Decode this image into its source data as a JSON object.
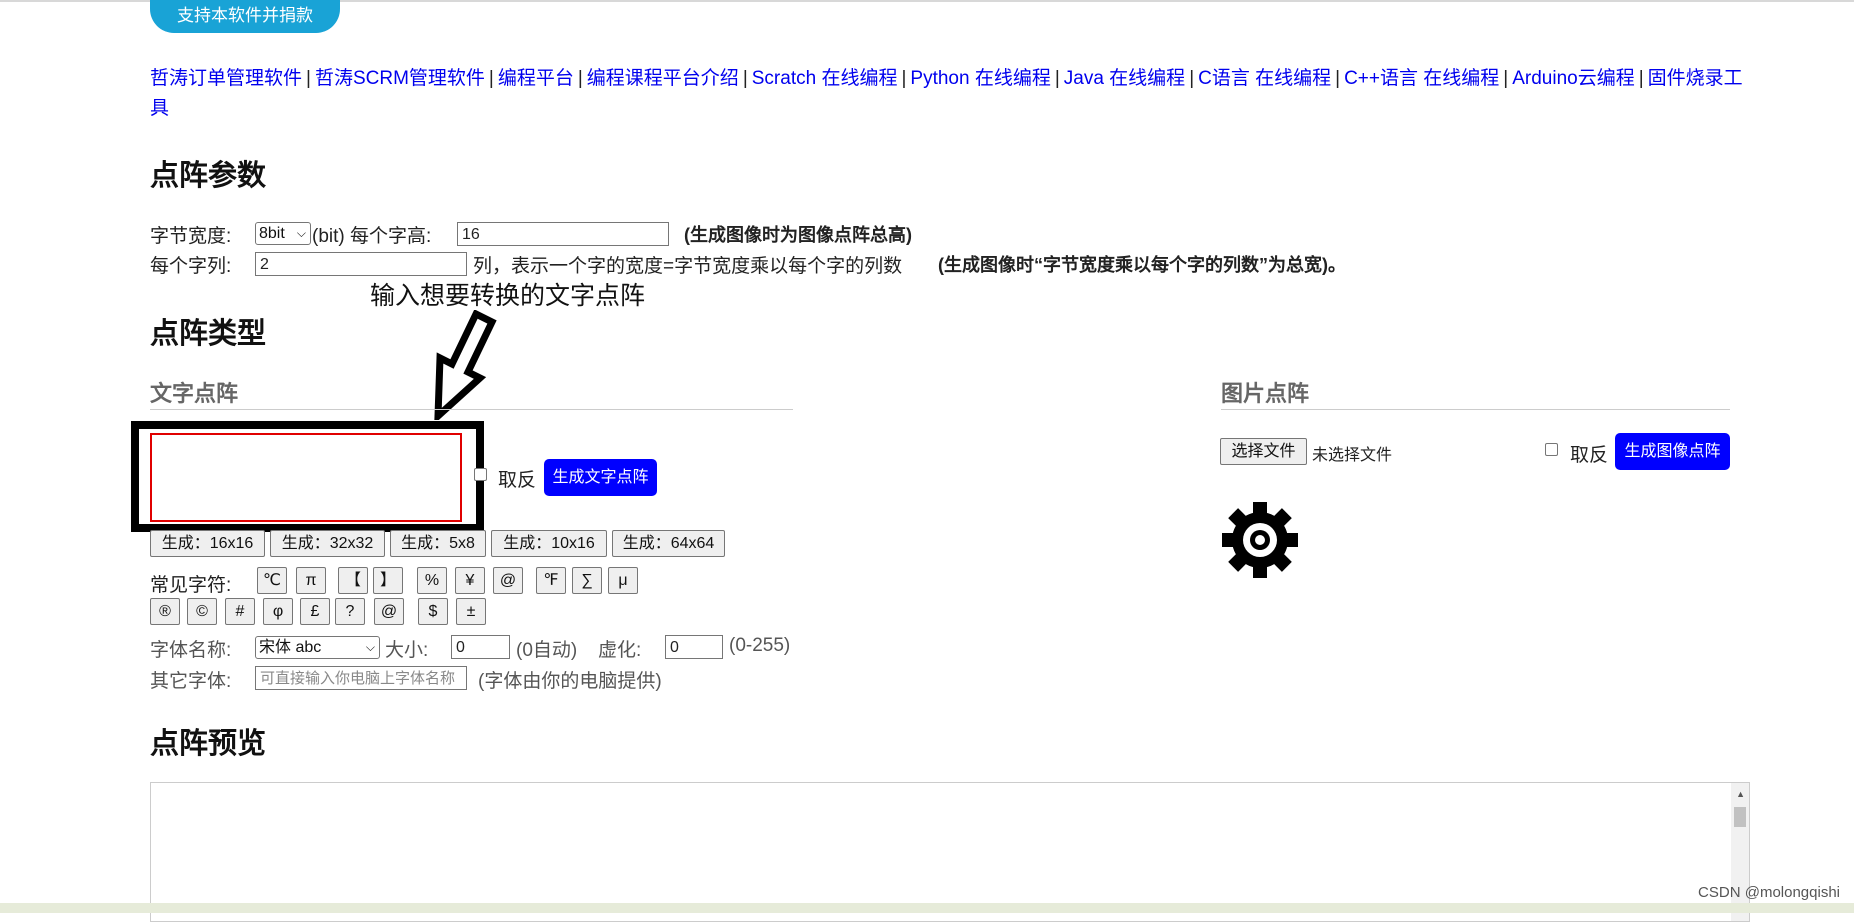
{
  "header": {
    "donate_label": "支持本软件并捐款"
  },
  "links": [
    "哲涛订单管理软件",
    "哲涛SCRM管理软件",
    "编程平台",
    "编程课程平台介绍",
    "Scratch 在线编程",
    "Python 在线编程",
    "Java 在线编程",
    "C语言 在线编程",
    "C++语言 在线编程",
    "Arduino云编程",
    "固件烧录工具"
  ],
  "link_separator": "|",
  "params": {
    "title": "点阵参数",
    "byte_width_label": "字节宽度:",
    "byte_width_value": "8bit",
    "bit_unit": "(bit)",
    "char_height_label": "每个字高:",
    "char_height_value": "16",
    "char_height_note": "(生成图像时为图像点阵总高)",
    "char_cols_label": "每个字列:",
    "char_cols_value": "2",
    "char_cols_desc": "列，表示一个字的宽度=字节宽度乘以每个字的列数",
    "char_cols_note": "(生成图像时“字节宽度乘以每个字的列数”为总宽)。"
  },
  "annotation": {
    "callout": "输入想要转换的文字点阵"
  },
  "types": {
    "title": "点阵类型",
    "text": {
      "heading": "文字点阵",
      "input_value": "",
      "invert_label": "取反",
      "generate_label": "生成文字点阵",
      "presets": [
        "生成：16x16",
        "生成：32x32",
        "生成：5x8",
        "生成：10x16",
        "生成：64x64"
      ],
      "common_label": "常见字符:",
      "symbols_row1": [
        "℃",
        "π",
        "【",
        "】",
        "%",
        "¥",
        "@",
        "℉",
        "∑",
        "μ"
      ],
      "symbols_row2": [
        "®",
        "©",
        "#",
        "φ",
        "£",
        "?",
        "@",
        "$",
        "±"
      ],
      "font_name_label": "字体名称:",
      "font_name_value": "宋体 abc",
      "size_label": "大小:",
      "size_value": "0",
      "size_note": "(0自动)",
      "blur_label": "虚化:",
      "blur_value": "0",
      "blur_note": "(0-255)",
      "other_font_label": "其它字体:",
      "other_font_placeholder": "可直接输入你电脑上字体名称",
      "other_font_note": "(字体由你的电脑提供)"
    },
    "image": {
      "heading": "图片点阵",
      "choose_file_label": "选择文件",
      "no_file_label": "未选择文件",
      "invert_label": "取反",
      "generate_label": "生成图像点阵",
      "gear_icon": "gear-icon"
    }
  },
  "preview": {
    "title": "点阵预览"
  },
  "watermark": "CSDN @molongqishi",
  "colors": {
    "link": "#0000ee",
    "accent_button": "#0000ff",
    "donate": "#19a3d6",
    "highlight_border": "#e00000"
  }
}
